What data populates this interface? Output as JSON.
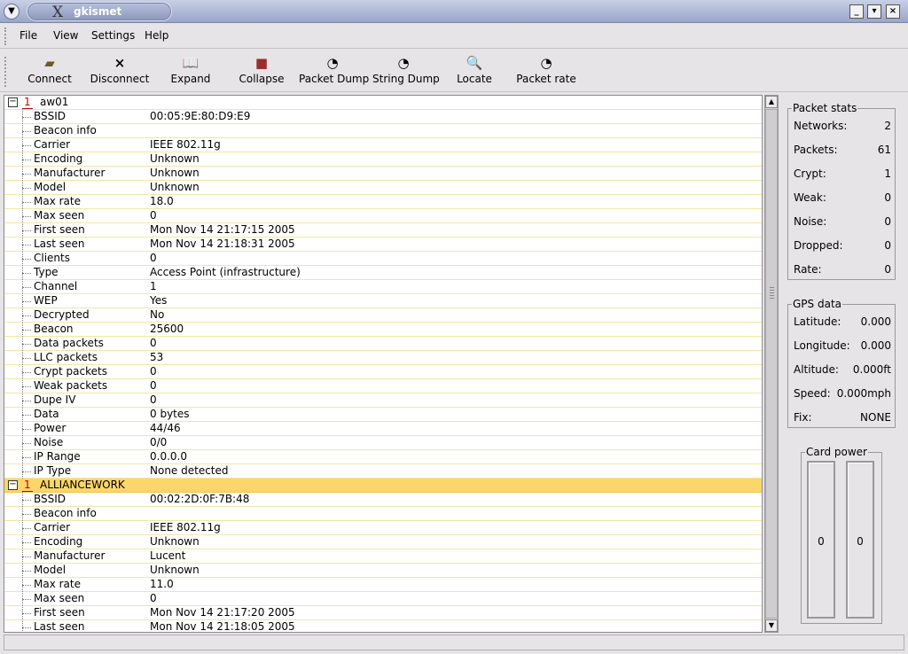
{
  "window": {
    "title": "gkismet"
  },
  "menu": {
    "file": "File",
    "view": "View",
    "settings": "Settings",
    "help": "Help"
  },
  "toolbar": {
    "connect": "Connect",
    "disconnect": "Disconnect",
    "expand": "Expand",
    "collapse": "Collapse",
    "packet_dump": "Packet Dump",
    "string_dump": "String Dump",
    "locate": "Locate",
    "packet_rate": "Packet rate"
  },
  "networks": [
    {
      "number": "1",
      "name": "aw01",
      "selected": false,
      "fields": [
        [
          "BSSID",
          "00:05:9E:80:D9:E9"
        ],
        [
          "Beacon info",
          ""
        ],
        [
          "Carrier",
          "IEEE 802.11g"
        ],
        [
          "Encoding",
          "Unknown"
        ],
        [
          "Manufacturer",
          "Unknown"
        ],
        [
          "Model",
          "Unknown"
        ],
        [
          "Max rate",
          "18.0"
        ],
        [
          "Max seen",
          "0"
        ],
        [
          "First seen",
          "Mon Nov 14 21:17:15 2005"
        ],
        [
          "Last seen",
          "Mon Nov 14 21:18:31 2005"
        ],
        [
          "Clients",
          "0"
        ],
        [
          "Type",
          "Access Point (infrastructure)"
        ],
        [
          "Channel",
          "1"
        ],
        [
          "WEP",
          "Yes"
        ],
        [
          "Decrypted",
          "No"
        ],
        [
          "Beacon",
          "25600"
        ],
        [
          "Data packets",
          "0"
        ],
        [
          "LLC packets",
          "53"
        ],
        [
          "Crypt packets",
          "0"
        ],
        [
          "Weak packets",
          "0"
        ],
        [
          "Dupe IV",
          "0"
        ],
        [
          "Data",
          "0 bytes"
        ],
        [
          "Power",
          "44/46"
        ],
        [
          "Noise",
          "0/0"
        ],
        [
          "IP Range",
          "0.0.0.0"
        ],
        [
          "IP Type",
          "None detected"
        ]
      ]
    },
    {
      "number": "1",
      "name": "ALLIANCEWORK",
      "selected": true,
      "fields": [
        [
          "BSSID",
          "00:02:2D:0F:7B:48"
        ],
        [
          "Beacon info",
          ""
        ],
        [
          "Carrier",
          "IEEE 802.11g"
        ],
        [
          "Encoding",
          "Unknown"
        ],
        [
          "Manufacturer",
          "Lucent"
        ],
        [
          "Model",
          "Unknown"
        ],
        [
          "Max rate",
          "11.0"
        ],
        [
          "Max seen",
          "0"
        ],
        [
          "First seen",
          "Mon Nov 14 21:17:20 2005"
        ],
        [
          "Last seen",
          "Mon Nov 14 21:18:05 2005"
        ]
      ]
    }
  ],
  "packet_stats": {
    "title": "Packet stats",
    "items": [
      [
        "Networks:",
        "2"
      ],
      [
        "Packets:",
        "61"
      ],
      [
        "Crypt:",
        "1"
      ],
      [
        "Weak:",
        "0"
      ],
      [
        "Noise:",
        "0"
      ],
      [
        "Dropped:",
        "0"
      ],
      [
        "Rate:",
        "0"
      ]
    ]
  },
  "gps": {
    "title": "GPS data",
    "items": [
      [
        "Latitude:",
        "0.000"
      ],
      [
        "Longitude:",
        "0.000"
      ],
      [
        "Altitude:",
        "0.000ft"
      ],
      [
        "Speed:",
        "0.000mph"
      ],
      [
        "Fix:",
        "NONE"
      ]
    ]
  },
  "card_power": {
    "title": "Card power",
    "left": "0",
    "right": "0"
  }
}
